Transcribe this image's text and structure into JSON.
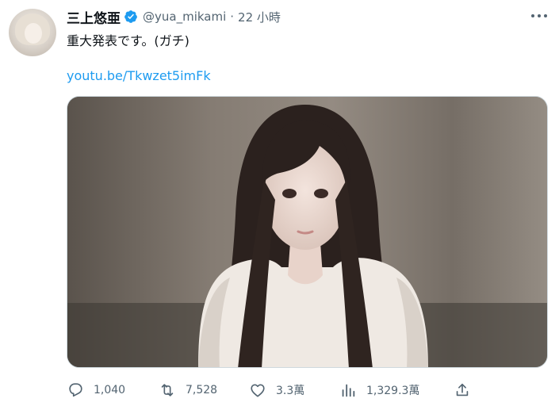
{
  "tweet": {
    "author_name": "三上悠亜",
    "handle": "@yua_mikami",
    "separator": "·",
    "time": "22 小時",
    "text": "重大発表です。(ガチ)",
    "link": "youtu.be/Tkwzet5imFk"
  },
  "icons": {
    "verified": "verified-badge-icon",
    "more": "more-options-icon",
    "reply": "reply-icon",
    "retweet": "retweet-icon",
    "like": "heart-icon",
    "views": "views-chart-icon",
    "share": "share-icon"
  },
  "actions": {
    "reply_count": "1,040",
    "retweet_count": "7,528",
    "like_count": "3.3萬",
    "views_count": "1,329.3萬"
  },
  "colors": {
    "link": "#1d9bf0",
    "verified": "#1d9bf0",
    "secondary_text": "#536471",
    "primary_text": "#0f1419"
  }
}
